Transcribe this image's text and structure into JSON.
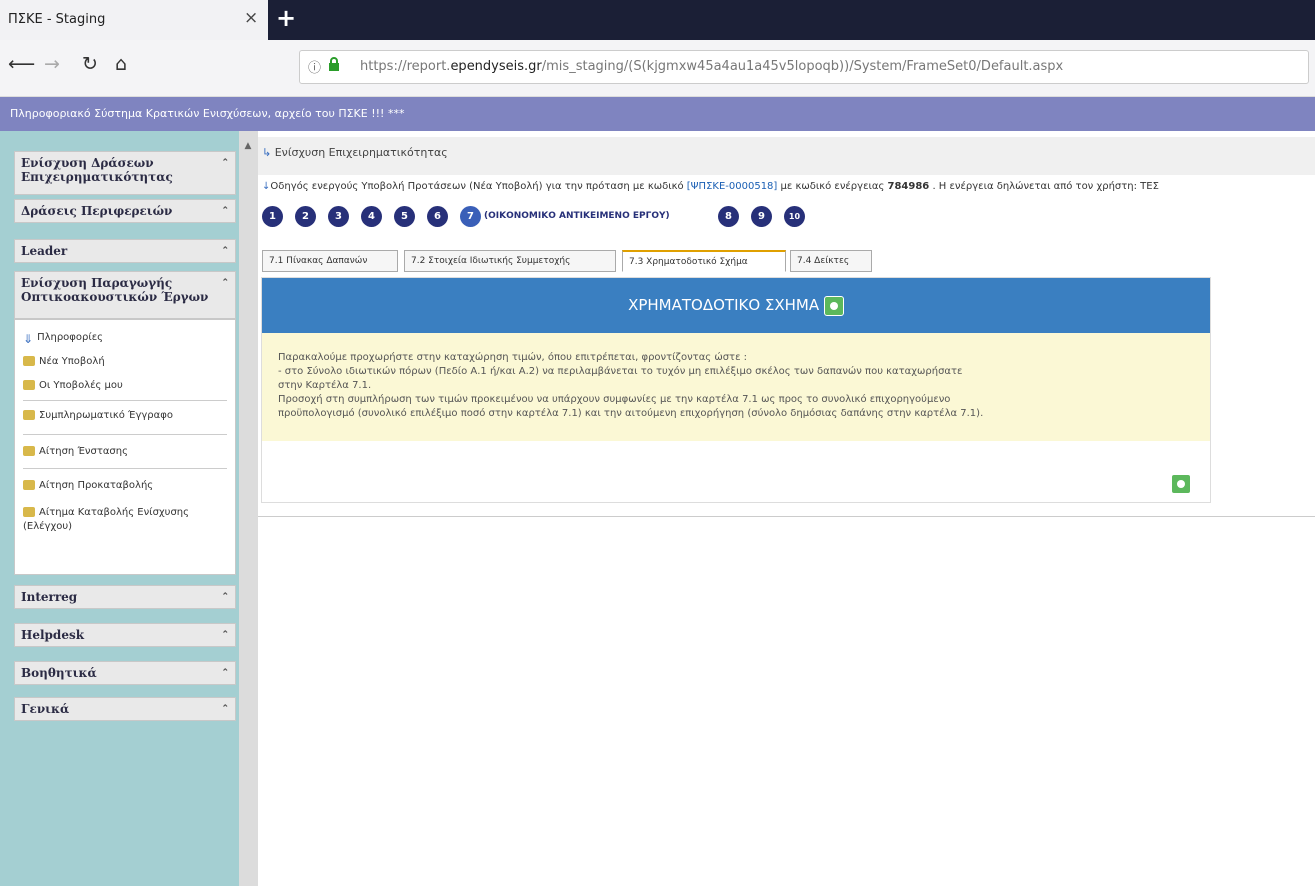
{
  "browser": {
    "tab_title": "ΠΣΚΕ - Staging",
    "tab_close": "×",
    "new_tab": "+",
    "url_prefix": "https://report.",
    "url_domain": "ependyseis.gr",
    "url_rest": "/mis_staging/(S(kjgmxw45a4au1a45v5lopoqb))/System/FrameSet0/Default.aspx"
  },
  "app": {
    "header_text": "Πληροφοριακό Σύστημα Κρατικών Ενισχύσεων, αρχείο του ΠΣΚΕ !!! ***"
  },
  "sidebar": {
    "menus": [
      {
        "label": "Ενίσχυση Δράσεων Επιχειρηματικότητας"
      },
      {
        "label": "Δράσεις Περιφερειών"
      },
      {
        "label": "Leader"
      },
      {
        "label": "Ενίσχυση Παραγωγής Οπτικοακουστικών Έργων"
      }
    ],
    "sub_items": [
      {
        "label": "Πληροφορίες"
      },
      {
        "label": "Νέα Υποβολή"
      },
      {
        "label": "Οι Υποβολές μου"
      },
      {
        "label": "Συμπληρωματικό Έγγραφο"
      },
      {
        "label": "Αίτηση Ένστασης"
      },
      {
        "label": "Αίτηση Προκαταβολής"
      },
      {
        "label": "Αίτημα Καταβολής Ενίσχυσης (Ελέγχου)"
      }
    ],
    "bottom_menus": [
      {
        "label": "Interreg"
      },
      {
        "label": "Helpdesk"
      },
      {
        "label": "Βοηθητικά"
      },
      {
        "label": "Γενικά"
      }
    ]
  },
  "main": {
    "breadcrumb": "Ενίσχυση Επιχειρηματικότητας",
    "info_prefix": "Οδηγός ενεργούς Υποβολή Προτάσεων (Νέα Υποβολή) για την πρόταση με κωδικό ",
    "info_code": "[ΨΠΣΚΕ-0000518]",
    "info_mid": " με κωδικό ενέργειας ",
    "info_num": "784986",
    "info_suffix": " . Η ενέργεια δηλώνεται από τον χρήστη: ΤΕΣ",
    "steps": [
      "1",
      "2",
      "3",
      "4",
      "5",
      "6",
      "7",
      "8",
      "9",
      "10"
    ],
    "step_label": "(ΟΙΚΟΝΟΜΙΚΟ ΑΝΤΙΚΕΙΜΕΝΟ ΕΡΓΟΥ)",
    "tabs": [
      {
        "label": "7.1 Πίνακας Δαπανών"
      },
      {
        "label": "7.2 Στοιχεία Ιδιωτικής Συμμετοχής"
      },
      {
        "label": "7.3 Χρηματοδοτικό Σχήμα"
      },
      {
        "label": "7.4 Δείκτες"
      }
    ],
    "panel_title": "ΧΡΗΜΑΤΟΔΟΤΙΚΟ ΣΧΗΜΑ",
    "note_line1": "Παρακαλούμε προχωρήστε στην καταχώρηση τιμών, όπου επιτρέπεται, φροντίζοντας ώστε :",
    "note_line2": " - στο Σύνολο ιδιωτικών πόρων (Πεδίο Α.1 ή/και Α.2) να περιλαμβάνεται το τυχόν μη επιλέξιμο σκέλος των δαπανών που καταχωρήσατε",
    "note_line3": "στην Καρτέλα 7.1.",
    "note_line4": "Προσοχή στη συμπλήρωση των τιμών προκειμένου να υπάρχουν συμφωνίες με την καρτέλα 7.1 ως προς το συνολικό επιχορηγούμενο",
    "note_line5": "προϋπολογισμό (συνολικό επιλέξιμο ποσό στην καρτέλα 7.1) και την αιτούμενη επιχορήγηση (σύνολο δημόσιας δαπάνης στην καρτέλα 7.1)."
  },
  "colors": {
    "panel_header": "#3a7fc1",
    "sidebar_bg": "#a4cfd2",
    "app_header": "#7f84c0",
    "note_bg": "#fbf8d5"
  }
}
